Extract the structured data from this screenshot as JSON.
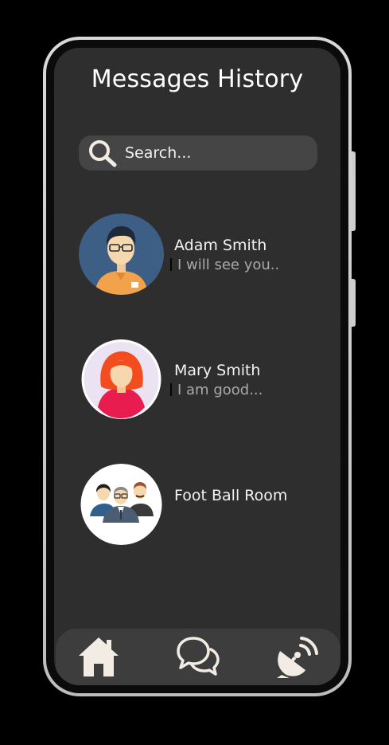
{
  "header": {
    "title": "Messages History"
  },
  "search": {
    "placeholder": "Search...",
    "icon": "search-icon"
  },
  "chats": [
    {
      "name": "Adam Smith",
      "preview": "I will see you..",
      "avatar": "male-user-avatar"
    },
    {
      "name": "Mary Smith",
      "preview": "I am good...",
      "avatar": "female-user-avatar"
    },
    {
      "name": "Foot Ball Room",
      "preview": "",
      "avatar": "group-avatar"
    }
  ],
  "bottom_nav": {
    "items": [
      {
        "icon": "home-icon"
      },
      {
        "icon": "chat-bubbles-icon"
      },
      {
        "icon": "satellite-dish-icon"
      }
    ]
  },
  "colors": {
    "background": "#000000",
    "screen": "#2e2e2e",
    "search_bar": "#454545",
    "nav_bar": "#3d3d3d",
    "icon": "#f3ece4",
    "text_primary": "#f3f3f3",
    "text_secondary": "#a9a9a9"
  }
}
